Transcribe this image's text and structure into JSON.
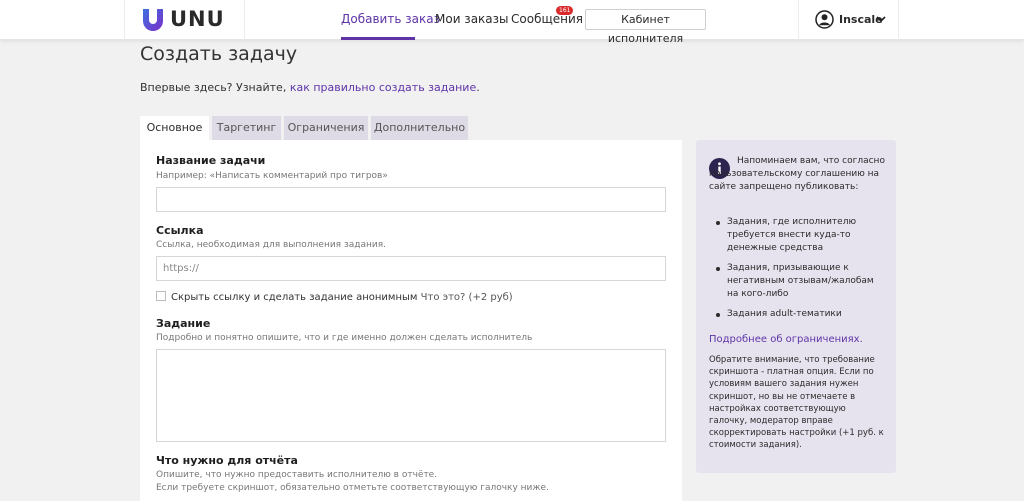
{
  "header": {
    "logo_text": "UNU",
    "nav": [
      {
        "label": "Добавить заказ",
        "active": true
      },
      {
        "label": "Мои заказы",
        "active": false
      },
      {
        "label": "Сообщения",
        "active": false
      }
    ],
    "messages_badge": "161",
    "cabinet_button": "Кабинет исполнителя",
    "user_name": "Inscale"
  },
  "page": {
    "title": "Создать задачу",
    "intro_text": "Впервые здесь? Узнайте, ",
    "intro_link": "как правильно создать задание",
    "intro_tail": "."
  },
  "tabs": [
    {
      "label": "Основное",
      "active": true
    },
    {
      "label": "Таргетинг",
      "active": false
    },
    {
      "label": "Ограничения",
      "active": false
    },
    {
      "label": "Дополнительно",
      "active": false
    }
  ],
  "form": {
    "task_name": {
      "label": "Название задачи",
      "hint": "Например: «Написать комментарий про тигров»",
      "value": ""
    },
    "link": {
      "label": "Ссылка",
      "hint": "Ссылка, необходимая для выполнения задания.",
      "placeholder": "https://"
    },
    "hide_link": {
      "label": "Скрыть ссылку и сделать задание анонимным",
      "extra": "Что это? (+2 руб)",
      "checked": false
    },
    "task": {
      "label": "Задание",
      "hint": "Подробно и понятно опишите, что и где именно должен сделать исполнитель"
    },
    "report": {
      "label": "Что нужно для отчёта",
      "hint_1": "Опишите, что нужно предоставить исполнителю в отчёте.",
      "hint_2": "Если требуете скриншот, обязательно отметьте соответствующую галочку ниже."
    }
  },
  "notice": {
    "head": "Напоминаем вам, что согласно пользовательскому соглашению на сайте запрещено публиковать:",
    "items": [
      "Задания, где исполнителю требуется внести куда-то денежные средства",
      "Задания, призывающие к негативным отзывам/жалобам на кого-либо",
      "Задания adult-тематики"
    ],
    "link": "Подробнее об ограничениях.",
    "footer": "Обратите внимание, что требование скриншота - платная опция. Если по условиям вашего задания нужен скриншот, но вы не отмечаете в настройках соответствующую галочку, модератор вправе скорректировать настройки (+1 руб. к стоимости задания)."
  },
  "colors": {
    "accent": "#5e34a8",
    "badge": "#d92b2b",
    "panel": "#e6e3ee",
    "background": "#f1f1f1"
  }
}
